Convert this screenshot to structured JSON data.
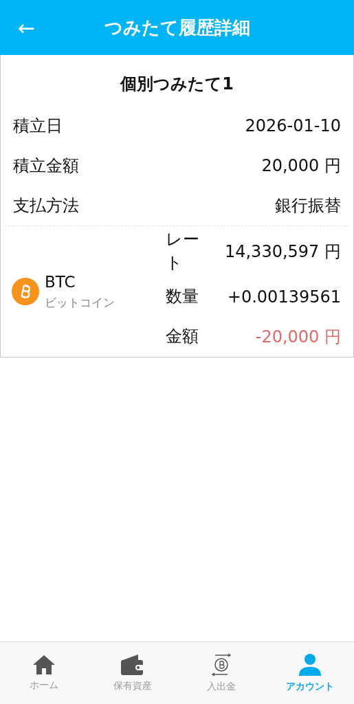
{
  "header": {
    "back": "←",
    "title": "つみたて履歴詳細"
  },
  "card": {
    "title": "個別つみたて1",
    "rows": [
      {
        "label": "積立日",
        "value": "2026-01-10"
      },
      {
        "label": "積立金額",
        "value": "20,000 円"
      },
      {
        "label": "支払方法",
        "value": "銀行振替"
      }
    ],
    "coin": {
      "symbol": "BTC",
      "name": "ビットコイン",
      "details": [
        {
          "label": "レート",
          "value": "14,330,597 円",
          "kind": "plain"
        },
        {
          "label": "数量",
          "value": "+0.00139561",
          "kind": "plain"
        },
        {
          "label": "金額",
          "value": "-20,000 円",
          "kind": "negative"
        }
      ]
    }
  },
  "nav": [
    {
      "label": "ホーム",
      "kind": "home",
      "selected": false
    },
    {
      "label": "保有資産",
      "kind": "wallet",
      "selected": false
    },
    {
      "label": "入出金",
      "kind": "transfer",
      "selected": false
    },
    {
      "label": "アカウント",
      "kind": "account",
      "selected": true
    }
  ]
}
